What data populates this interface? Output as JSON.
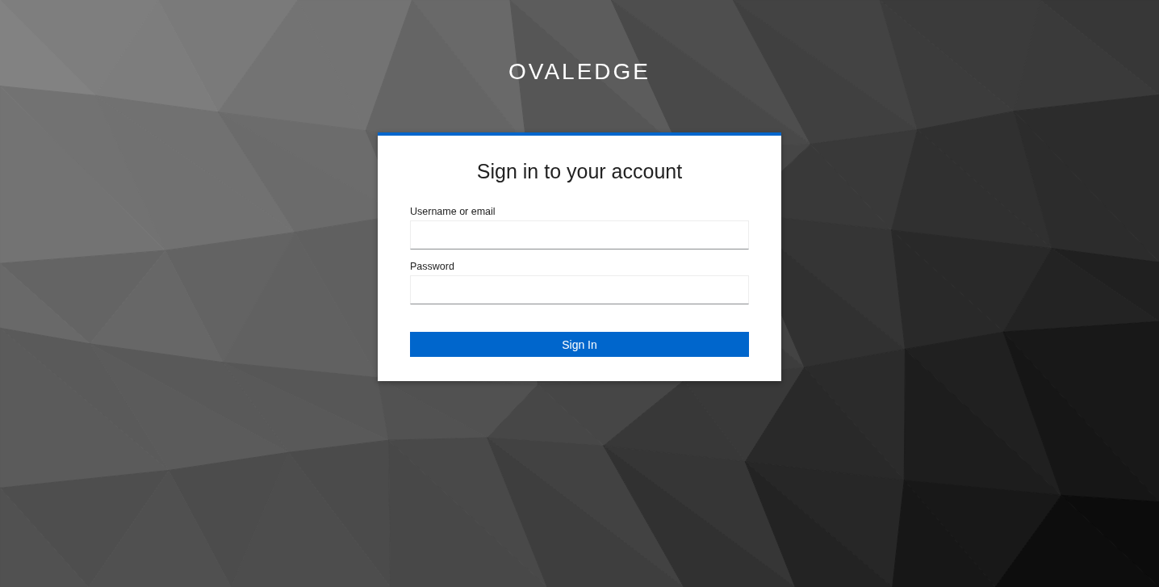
{
  "brand": {
    "name": "OVALEDGE"
  },
  "login": {
    "title": "Sign in to your account",
    "fields": [
      {
        "label": "Username or email"
      },
      {
        "label": "Password"
      }
    ],
    "submit": "Sign In"
  }
}
